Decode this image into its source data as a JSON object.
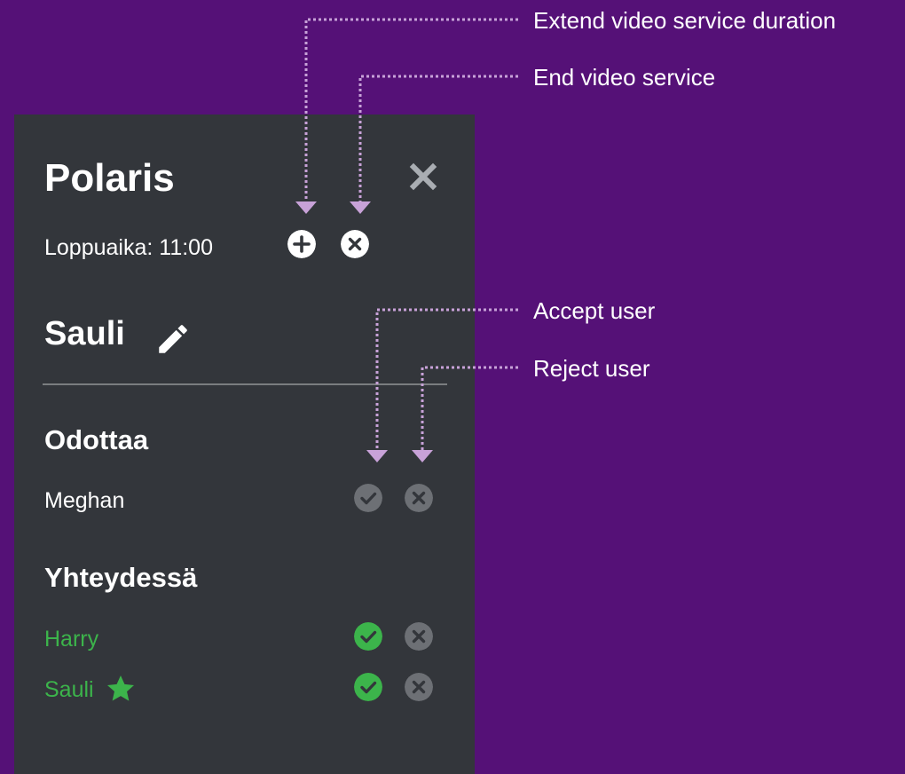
{
  "panel": {
    "title": "Polaris",
    "end_time": "Loppuaika: 11:00",
    "user_name": "Sauli",
    "sections": [
      {
        "heading": "Odottaa",
        "people": [
          {
            "name": "Meghan"
          }
        ]
      },
      {
        "heading": "Yhteydessä",
        "people": [
          {
            "name": "Harry"
          },
          {
            "name": "Sauli",
            "icon": "star-icon"
          }
        ]
      }
    ]
  },
  "annotations": {
    "extend": "Extend video service duration",
    "end": "End video service",
    "accept": "Accept user",
    "reject": "Reject user"
  },
  "colors": {
    "background": "#551177",
    "panel": "#33363b",
    "connected_green": "#3cb44b",
    "pending_gray": "#6d7075",
    "annotation_line": "#c8a2d8"
  },
  "icons": [
    "close-icon",
    "plus-circle-icon",
    "x-circle-icon",
    "pencil-icon",
    "check-circle-icon",
    "star-icon"
  ]
}
